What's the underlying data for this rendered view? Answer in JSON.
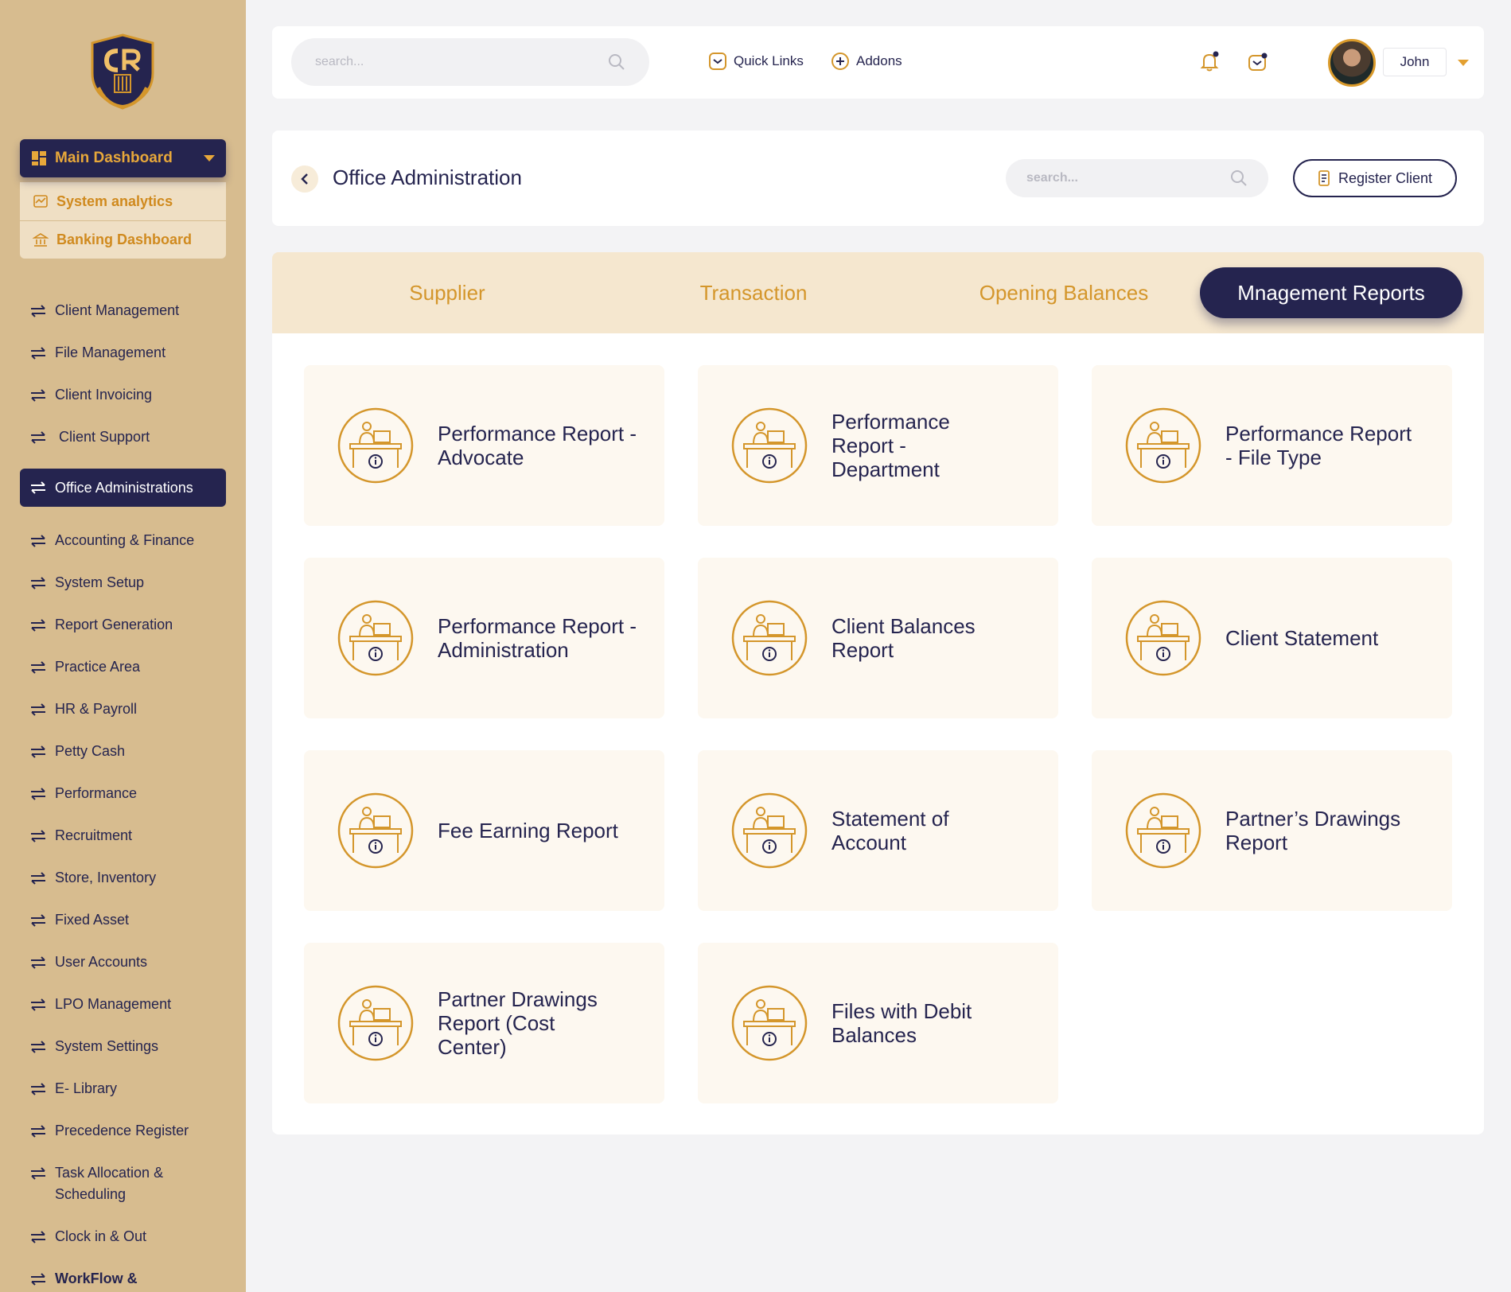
{
  "sidebar": {
    "dashboards": {
      "main_label": "Main Dashboard",
      "sub_items": [
        {
          "label": "System analytics",
          "icon": "analytics-icon"
        },
        {
          "label": "Banking Dashboard",
          "icon": "bank-icon"
        }
      ]
    },
    "items": [
      {
        "label": "Client Management"
      },
      {
        "label": "File Management"
      },
      {
        "label": "Client Invoicing"
      },
      {
        "label": " Client Support"
      },
      {
        "label": "Office Administrations",
        "active": true
      },
      {
        "label": "Accounting & Finance"
      },
      {
        "label": "System Setup"
      },
      {
        "label": "Report Generation"
      },
      {
        "label": "Practice Area"
      },
      {
        "label": "HR & Payroll"
      },
      {
        "label": "Petty Cash"
      },
      {
        "label": "Performance"
      },
      {
        "label": "Recruitment"
      },
      {
        "label": "Store, Inventory"
      },
      {
        "label": "Fixed Asset"
      },
      {
        "label": "User Accounts"
      },
      {
        "label": "LPO Management"
      },
      {
        "label": "System Settings"
      },
      {
        "label": "E- Library"
      },
      {
        "label": "Precedence Register"
      },
      {
        "label": "Task Allocation & Scheduling"
      },
      {
        "label": "Clock in & Out"
      },
      {
        "label": "WorkFlow &"
      }
    ]
  },
  "topbar": {
    "search_placeholder": "search...",
    "quick_links": "Quick Links",
    "addons": "Addons",
    "user_name": "John"
  },
  "header": {
    "title": "Office Administration",
    "search_placeholder": "search...",
    "register_button": "Register Client"
  },
  "tabs": [
    {
      "label": "Supplier"
    },
    {
      "label": "Transaction"
    },
    {
      "label": "Opening Balances"
    },
    {
      "label": "Mnagement Reports",
      "active": true
    }
  ],
  "reports": [
    {
      "label": "Performance Report - Advocate"
    },
    {
      "label": "Performance Report - Department"
    },
    {
      "label": "Performance Report - File Type"
    },
    {
      "label": "Performance Report - Administration"
    },
    {
      "label": "Client Balances Report"
    },
    {
      "label": "Client Statement"
    },
    {
      "label": "Fee Earning Report"
    },
    {
      "label": "Statement of Account"
    },
    {
      "label": "Partner’s Drawings Report"
    },
    {
      "label": "Partner Drawings Report (Cost Center)"
    },
    {
      "label": "Files with Debit Balances"
    }
  ],
  "colors": {
    "sidebar_bg": "#d7bc8f",
    "navy": "#25244f",
    "gold": "#d4962b",
    "card_bg": "#fdf8f0"
  }
}
